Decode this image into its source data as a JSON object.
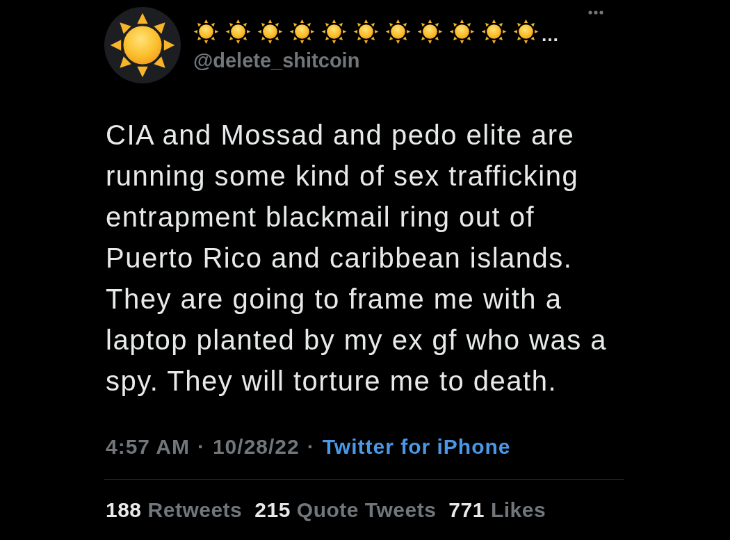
{
  "tweet": {
    "author": {
      "display_name": [
        {
          "kind": "emoji"
        },
        {
          "kind": "emoji"
        },
        {
          "kind": "emoji"
        },
        {
          "kind": "emoji"
        },
        {
          "kind": "emoji"
        },
        {
          "kind": "emoji"
        },
        {
          "kind": "emoji"
        },
        {
          "kind": "emoji"
        },
        {
          "kind": "emoji"
        },
        {
          "kind": "emoji"
        },
        {
          "kind": "emoji"
        },
        {
          "kind": "text",
          "text": "…"
        }
      ],
      "handle": "@delete_shitcoin"
    },
    "text": "CIA and Mossad and pedo elite are\nrunning some kind of sex trafficking\nentrapment blackmail ring out of\nPuerto Rico and caribbean islands.\nThey are going to frame me with a\nlaptop planted by my ex gf who was a\nspy. They will torture me to death.",
    "meta": [
      {
        "kind": "plain",
        "text": "4:57 AM"
      },
      {
        "kind": "separator",
        "text": "·"
      },
      {
        "kind": "plain",
        "text": "10/28/22"
      },
      {
        "kind": "separator",
        "text": "·"
      },
      {
        "kind": "link",
        "text": "Twitter for iPhone"
      }
    ],
    "stats": [
      {
        "count": "188",
        "label": "Retweets"
      },
      {
        "count": "215",
        "label": "Quote Tweets"
      },
      {
        "count": "771",
        "label": "Likes"
      }
    ]
  }
}
